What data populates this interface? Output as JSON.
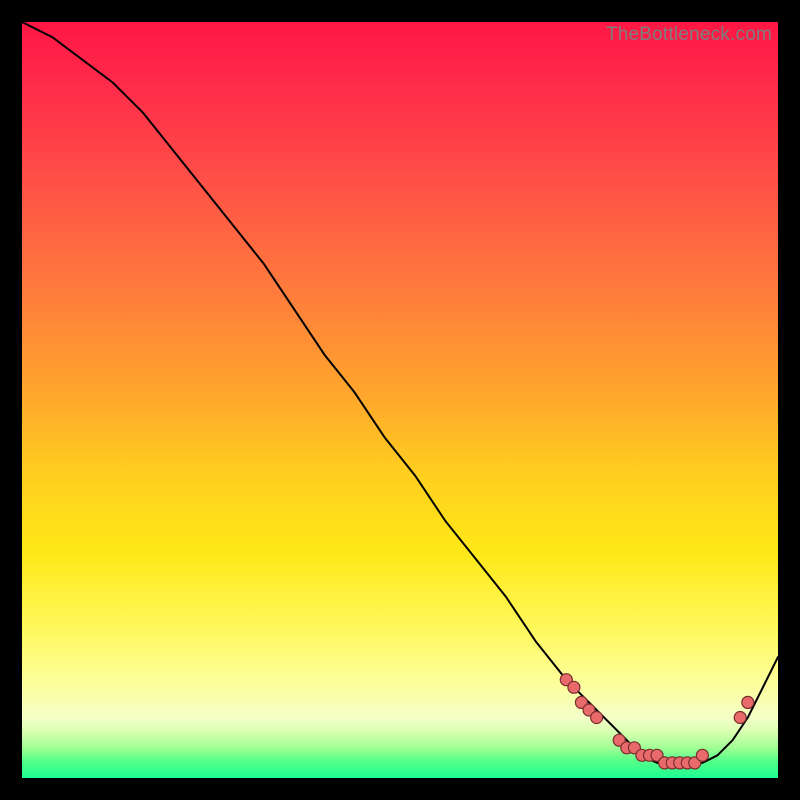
{
  "attribution": "TheBottleneck.com",
  "chart_data": {
    "type": "line",
    "title": "",
    "xlabel": "",
    "ylabel": "",
    "xlim": [
      0,
      100
    ],
    "ylim": [
      0,
      100
    ],
    "series": [
      {
        "name": "curve",
        "x": [
          0,
          4,
          8,
          12,
          16,
          20,
          24,
          28,
          32,
          36,
          40,
          44,
          48,
          52,
          56,
          60,
          64,
          68,
          72,
          74,
          76,
          78,
          80,
          82,
          84,
          86,
          88,
          90,
          92,
          94,
          96,
          98,
          100
        ],
        "y": [
          100,
          98,
          95,
          92,
          88,
          83,
          78,
          73,
          68,
          62,
          56,
          51,
          45,
          40,
          34,
          29,
          24,
          18,
          13,
          11,
          9,
          7,
          5,
          3,
          2,
          2,
          2,
          2,
          3,
          5,
          8,
          12,
          16
        ]
      }
    ],
    "markers": [
      {
        "x": 72,
        "y": 13
      },
      {
        "x": 73,
        "y": 12
      },
      {
        "x": 74,
        "y": 10
      },
      {
        "x": 75,
        "y": 9
      },
      {
        "x": 76,
        "y": 8
      },
      {
        "x": 79,
        "y": 5
      },
      {
        "x": 80,
        "y": 4
      },
      {
        "x": 81,
        "y": 4
      },
      {
        "x": 82,
        "y": 3
      },
      {
        "x": 83,
        "y": 3
      },
      {
        "x": 84,
        "y": 3
      },
      {
        "x": 85,
        "y": 2
      },
      {
        "x": 86,
        "y": 2
      },
      {
        "x": 87,
        "y": 2
      },
      {
        "x": 88,
        "y": 2
      },
      {
        "x": 89,
        "y": 2
      },
      {
        "x": 90,
        "y": 3
      },
      {
        "x": 95,
        "y": 8
      },
      {
        "x": 96,
        "y": 10
      }
    ],
    "colors": {
      "curve": "#000000",
      "markers_fill": "#e86a6a",
      "markers_stroke": "#7a2e2e",
      "gradient_top": "#ff1744",
      "gradient_bottom": "#1dff93"
    }
  }
}
